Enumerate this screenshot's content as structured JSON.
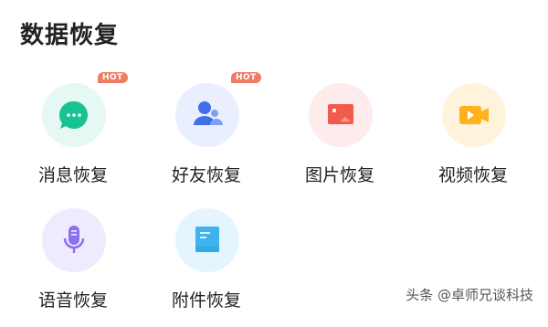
{
  "page": {
    "title": "数据恢复"
  },
  "tiles": [
    {
      "label": "消息恢复",
      "badge": "HOT",
      "icon": "chat-bubble-icon",
      "bg": "#e6f8f3",
      "fg": "#19c391"
    },
    {
      "label": "好友恢复",
      "badge": "HOT",
      "icon": "contacts-icon",
      "bg": "#e9efff",
      "fg": "#3f6fe8"
    },
    {
      "label": "图片恢复",
      "badge": "",
      "icon": "image-icon",
      "bg": "#fdeceb",
      "fg": "#f25a4b"
    },
    {
      "label": "视频恢复",
      "badge": "",
      "icon": "video-camera-icon",
      "bg": "#fff3dc",
      "fg": "#ffb21e"
    },
    {
      "label": "语音恢复",
      "badge": "",
      "icon": "microphone-icon",
      "bg": "#efebff",
      "fg": "#8a6ff0"
    },
    {
      "label": "附件恢复",
      "badge": "",
      "icon": "document-icon",
      "bg": "#e5f5fd",
      "fg": "#3eb3ee"
    }
  ],
  "watermark": "头条 @卓师兄谈科技"
}
